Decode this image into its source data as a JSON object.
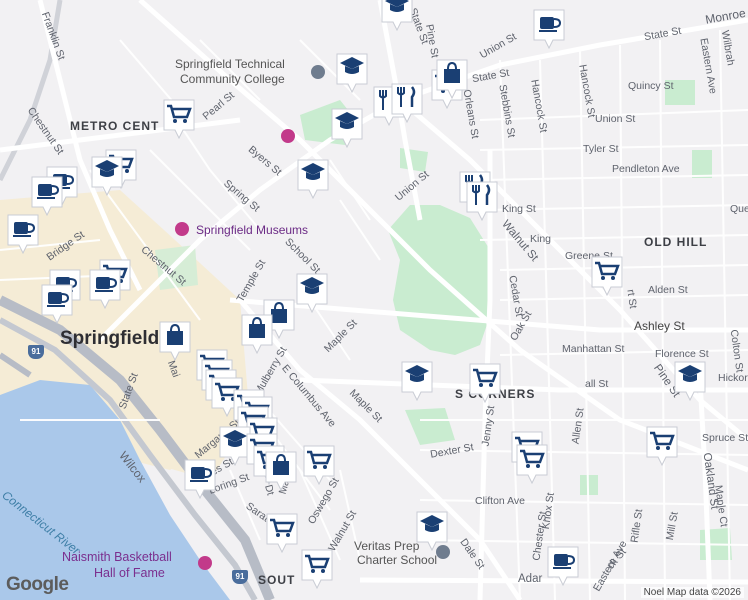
{
  "map": {
    "streets": [
      {
        "id": "franklin",
        "text": "Franklin St"
      },
      {
        "id": "chestnut1",
        "text": "Chestnut St"
      },
      {
        "id": "chestnut2",
        "text": "Chestnut St"
      },
      {
        "id": "pearl",
        "text": "Pearl St"
      },
      {
        "id": "byers",
        "text": "Byers St"
      },
      {
        "id": "spring",
        "text": "Spring St"
      },
      {
        "id": "temple",
        "text": "Temple St"
      },
      {
        "id": "school",
        "text": "School St"
      },
      {
        "id": "bridge",
        "text": "Bridge St"
      },
      {
        "id": "state1",
        "text": "State St"
      },
      {
        "id": "state2",
        "text": "State St"
      },
      {
        "id": "state3",
        "text": "State St"
      },
      {
        "id": "state4",
        "text": "State St"
      },
      {
        "id": "union1",
        "text": "Union St"
      },
      {
        "id": "union2",
        "text": "Union St"
      },
      {
        "id": "union3",
        "text": "Union St"
      },
      {
        "id": "mulberry",
        "text": "Mulberry St"
      },
      {
        "id": "maple1",
        "text": "Maple St"
      },
      {
        "id": "maple2",
        "text": "Maple St"
      },
      {
        "id": "dale",
        "text": "Dale St"
      },
      {
        "id": "ecolumbus",
        "text": "E Columbus Ave"
      },
      {
        "id": "wilcox",
        "text": "Wilcox"
      },
      {
        "id": "margaret",
        "text": "Margaret St"
      },
      {
        "id": "loring",
        "text": "Loring St"
      },
      {
        "id": "saratoga",
        "text": "Saratoga St"
      },
      {
        "id": "oswego",
        "text": "Oswego St"
      },
      {
        "id": "walnut1",
        "text": "Walnut St"
      },
      {
        "id": "walnut2",
        "text": "Walnut St"
      },
      {
        "id": "pine1",
        "text": "Pine St"
      },
      {
        "id": "pine2",
        "text": "Pine St"
      },
      {
        "id": "jenny",
        "text": "Jenny St"
      },
      {
        "id": "cedar",
        "text": "Cedar St"
      },
      {
        "id": "oak",
        "text": "Oak St"
      },
      {
        "id": "orleans",
        "text": "Orleans St"
      },
      {
        "id": "stebbins",
        "text": "Stebbins St"
      },
      {
        "id": "hancock1",
        "text": "Hancock St"
      },
      {
        "id": "hancock2",
        "text": "Hancock St"
      },
      {
        "id": "eastern1",
        "text": "Eastern Ave"
      },
      {
        "id": "eastern2",
        "text": "Eastern Ave"
      },
      {
        "id": "colton",
        "text": "Colton St"
      },
      {
        "id": "wilbraham",
        "text": "Wilbrah"
      },
      {
        "id": "monroe",
        "text": "Monroe St"
      },
      {
        "id": "quincy",
        "text": "Quincy St"
      },
      {
        "id": "tyler",
        "text": "Tyler St"
      },
      {
        "id": "pendleton",
        "text": "Pendleton Ave"
      },
      {
        "id": "king1",
        "text": "King St"
      },
      {
        "id": "king2",
        "text": "King"
      },
      {
        "id": "queen",
        "text": "Queen St"
      },
      {
        "id": "greene",
        "text": "Greene St"
      },
      {
        "id": "alden",
        "text": "Alden St"
      },
      {
        "id": "ashley",
        "text": "Ashley St"
      },
      {
        "id": "manhattan",
        "text": "Manhattan St"
      },
      {
        "id": "florence",
        "text": "Florence St"
      },
      {
        "id": "hall",
        "text": "all St"
      },
      {
        "id": "hickory",
        "text": "Hickory S"
      },
      {
        "id": "spruce",
        "text": "Spruce St"
      },
      {
        "id": "allen",
        "text": "Allen St"
      },
      {
        "id": "oakland",
        "text": "Oakland St"
      },
      {
        "id": "maplect",
        "text": "Maple Ct"
      },
      {
        "id": "dexter",
        "text": "Dexter St"
      },
      {
        "id": "clifton",
        "text": "Clifton Ave"
      },
      {
        "id": "knox",
        "text": "Knox St"
      },
      {
        "id": "chester",
        "text": "Chester St"
      },
      {
        "id": "rifle",
        "text": "Rifle St"
      },
      {
        "id": "mill",
        "text": "Mill St"
      },
      {
        "id": "adams",
        "text": "Adar"
      },
      {
        "id": "main1",
        "text": "Main"
      },
      {
        "id": "main2",
        "text": "Mai"
      },
      {
        "id": "dt",
        "text": "Dt"
      },
      {
        "id": "ck",
        "text": "ck St"
      },
      {
        "id": "rtst",
        "text": "rt St"
      },
      {
        "id": "es",
        "text": "es St"
      }
    ],
    "areas": [
      {
        "id": "metro",
        "text": "METRO CENT"
      },
      {
        "id": "oldhill",
        "text": "OLD HILL"
      },
      {
        "id": "sixcorners",
        "text": "S  CORNERS"
      },
      {
        "id": "south",
        "text": "SOUT"
      }
    ],
    "city": "Springfield",
    "places": {
      "stcc_line1": "Springfield Technical",
      "stcc_line2": "Community College",
      "museums": "Springfield Museums",
      "veritas_line1": "Veritas Prep",
      "veritas_line2": "Charter School",
      "naismith_line1": "Naismith Basketball",
      "naismith_line2": "Hall of Fame"
    },
    "water": "Connecticut River",
    "route_shield": "91",
    "attribution": "Noel Map data ©2026",
    "logo": "Google",
    "marker_types": {
      "education": "graduation-cap-icon",
      "cafe": "coffee-cup-icon",
      "grocery": "shopping-cart-icon",
      "shopping": "shopping-bag-icon",
      "restaurant": "fork-knife-icon"
    },
    "colors": {
      "marker_fill": "#ffffff",
      "marker_icon": "#1a3f73",
      "park": "#c9ecd0",
      "water": "#aac8ea",
      "downtown": "#f4ecd6"
    }
  }
}
